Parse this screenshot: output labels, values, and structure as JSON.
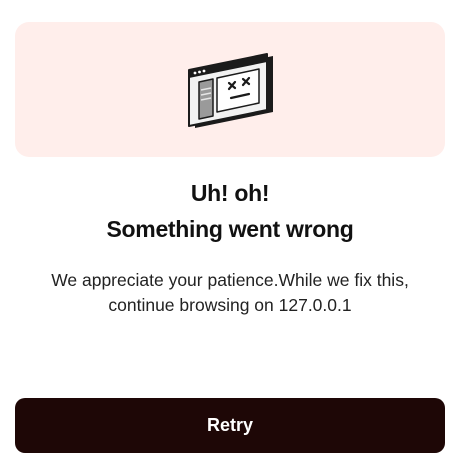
{
  "error_card": {
    "illustration": "browser-window-error-icon",
    "heading_line1": "Uh! oh!",
    "heading_line2": "Something went wrong",
    "message_line1": "We appreciate your patience.While we fix this,",
    "message_line2": "continue browsing on 127.0.0.1",
    "retry_label": "Retry"
  },
  "colors": {
    "hero_background": "#ffeeeb",
    "button_background": "#1e0706",
    "button_text": "#ffffff",
    "heading_text": "#111111"
  }
}
